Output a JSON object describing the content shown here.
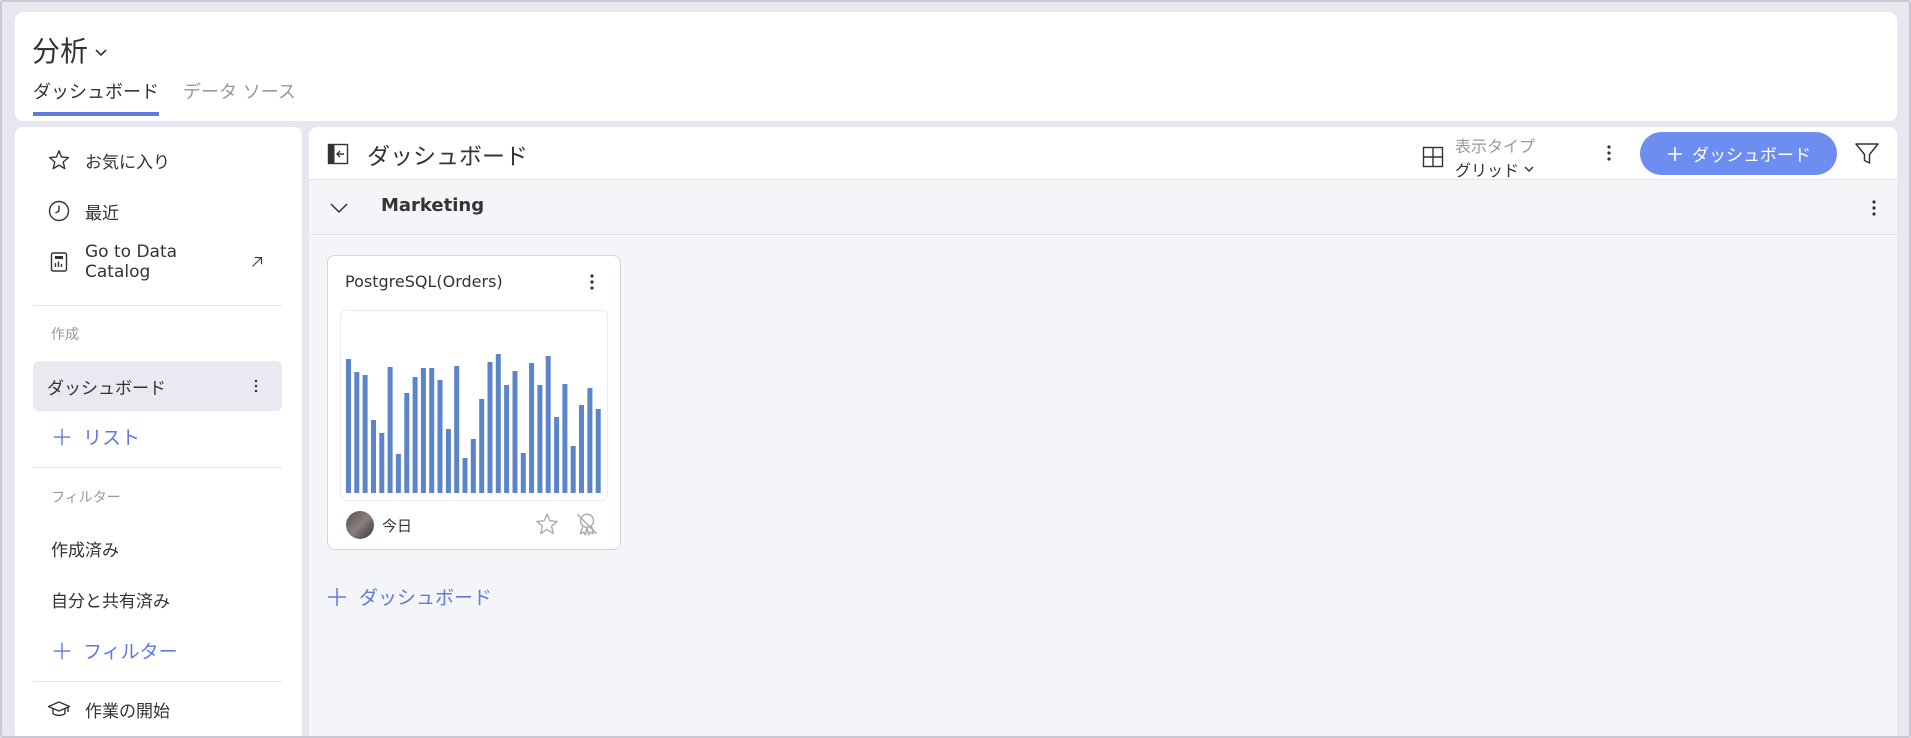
{
  "header": {
    "app_title": "分析",
    "tabs": [
      {
        "label": "ダッシュボード",
        "active": true
      },
      {
        "label": "データ ソース",
        "active": false
      }
    ]
  },
  "sidebar": {
    "items": [
      {
        "label": "お気に入り",
        "icon": "star-icon"
      },
      {
        "label": "最近",
        "icon": "clock-icon"
      },
      {
        "label": "Go to Data Catalog",
        "icon": "catalog-icon"
      }
    ],
    "create_section": "作成",
    "create_selected": "ダッシュボード",
    "add_list": "リスト",
    "filter_section": "フィルター",
    "filters": [
      "作成済み",
      "自分と共有済み"
    ],
    "add_filter": "フィルター",
    "getting_started": "作業の開始"
  },
  "toolbar": {
    "title": "ダッシュボード",
    "view_type_label": "表示タイプ",
    "view_type_value": "グリッド",
    "add_button": "ダッシュボード"
  },
  "group": {
    "title": "Marketing"
  },
  "card": {
    "title": "PostgreSQL(Orders)",
    "date": "今日",
    "thumbnail_bars": [
      134,
      121,
      118,
      73,
      60,
      126,
      39,
      100,
      116,
      125,
      125,
      113,
      64,
      127,
      35,
      54,
      94,
      131,
      139,
      108,
      122,
      40,
      130,
      108,
      137,
      76,
      109,
      47,
      88,
      105,
      84
    ],
    "bar_color": "#5b84c9"
  },
  "add_dashboard_link": "ダッシュボード",
  "colors": {
    "accent": "#5b7be0",
    "button": "#6d8ef0"
  }
}
